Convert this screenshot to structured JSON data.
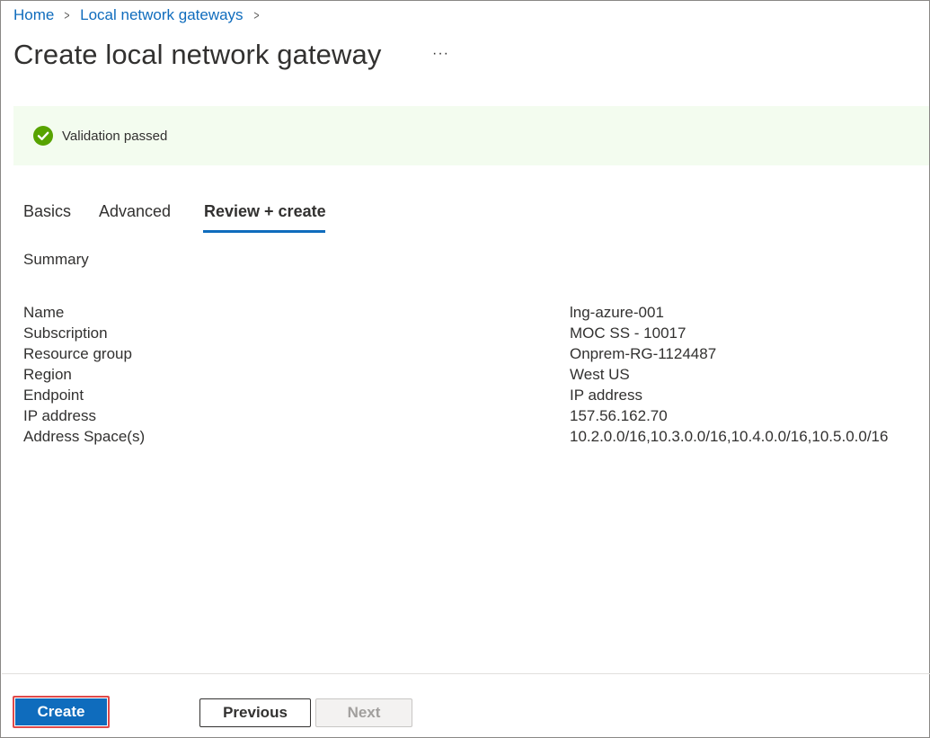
{
  "breadcrumb": {
    "items": [
      "Home",
      "Local network gateways"
    ]
  },
  "page": {
    "title": "Create local network gateway",
    "more": "···"
  },
  "validation": {
    "text": "Validation passed",
    "status_color": "#57a300"
  },
  "tabs": [
    {
      "label": "Basics",
      "active": false
    },
    {
      "label": "Advanced",
      "active": false
    },
    {
      "label": "Review + create",
      "active": true
    }
  ],
  "summary": {
    "heading": "Summary",
    "rows": [
      {
        "label": "Name",
        "value": "lng-azure-001"
      },
      {
        "label": "Subscription",
        "value": "MOC SS - 10017"
      },
      {
        "label": "Resource group",
        "value": "Onprem-RG-1124487"
      },
      {
        "label": "Region",
        "value": "West US"
      },
      {
        "label": "Endpoint",
        "value": "IP address"
      },
      {
        "label": "IP address",
        "value": "157.56.162.70"
      },
      {
        "label": "Address Space(s)",
        "value": "10.2.0.0/16,10.3.0.0/16,10.4.0.0/16,10.5.0.0/16"
      }
    ]
  },
  "footer": {
    "create_label": "Create",
    "previous_label": "Previous",
    "next_label": "Next"
  },
  "colors": {
    "accent": "#0f6cbd",
    "highlight_outline": "#e04a4a"
  }
}
